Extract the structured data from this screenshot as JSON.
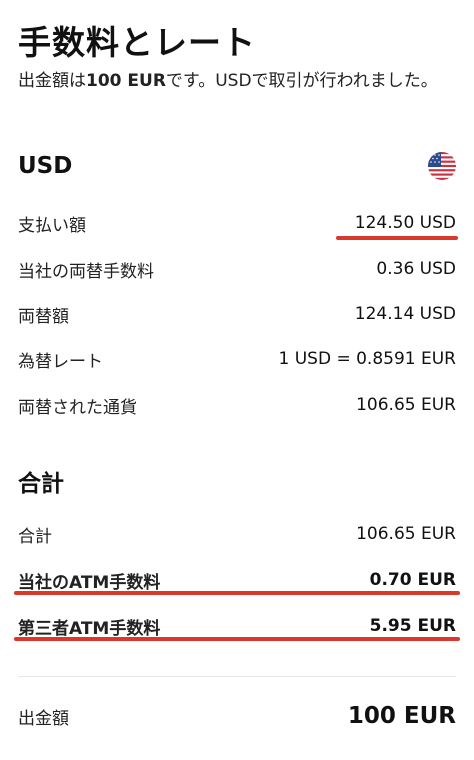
{
  "header": {
    "title": "手数料とレート",
    "subtitle_pre": "出金額は",
    "subtitle_amount": "100 EUR",
    "subtitle_post": "です。USDで取引が行われました。"
  },
  "usd_section": {
    "title": "USD",
    "flag_icon": "us-flag-icon",
    "rows": [
      {
        "label": "支払い額",
        "value": "124.50 USD"
      },
      {
        "label": "当社の両替手数料",
        "value": "0.36 USD"
      },
      {
        "label": "両替額",
        "value": "124.14 USD"
      },
      {
        "label": "為替レート",
        "value": "1 USD = 0.8591 EUR"
      },
      {
        "label": "両替された通貨",
        "value": "106.65 EUR"
      }
    ]
  },
  "total_section": {
    "title": "合計",
    "rows": [
      {
        "label": "合計",
        "value": "106.65 EUR"
      },
      {
        "label": "当社のATM手数料",
        "value": "0.70 EUR"
      },
      {
        "label": "第三者ATM手数料",
        "value": "5.95 EUR"
      }
    ]
  },
  "withdrawal": {
    "label": "出金額",
    "value": "100 EUR"
  },
  "colors": {
    "highlight_underline": "#d9392b"
  }
}
